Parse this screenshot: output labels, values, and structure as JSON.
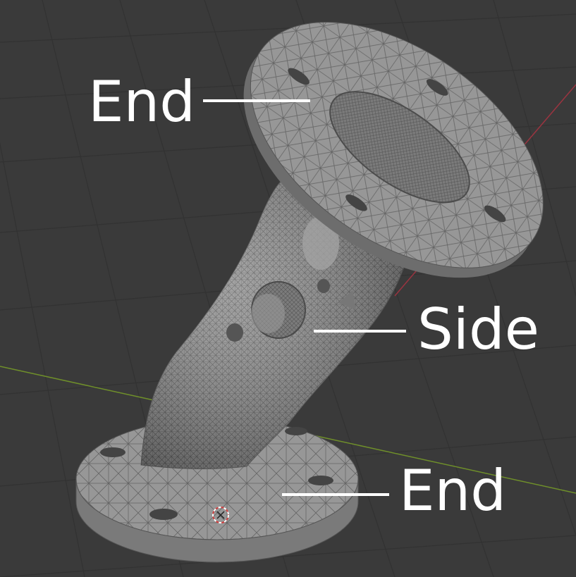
{
  "labels": {
    "top_end": "End",
    "side": "Side",
    "bottom_end": "End"
  },
  "colors": {
    "background": "#3a3a3a",
    "grid_line": "#2f2f2f",
    "x_axis": "#a0343c",
    "y_axis": "#6f8f2a",
    "mesh_fill": "#8e8e8e",
    "mesh_edge": "#555555",
    "label": "#ffffff"
  },
  "icons": {
    "origin_marker": "origin-marker-icon"
  }
}
